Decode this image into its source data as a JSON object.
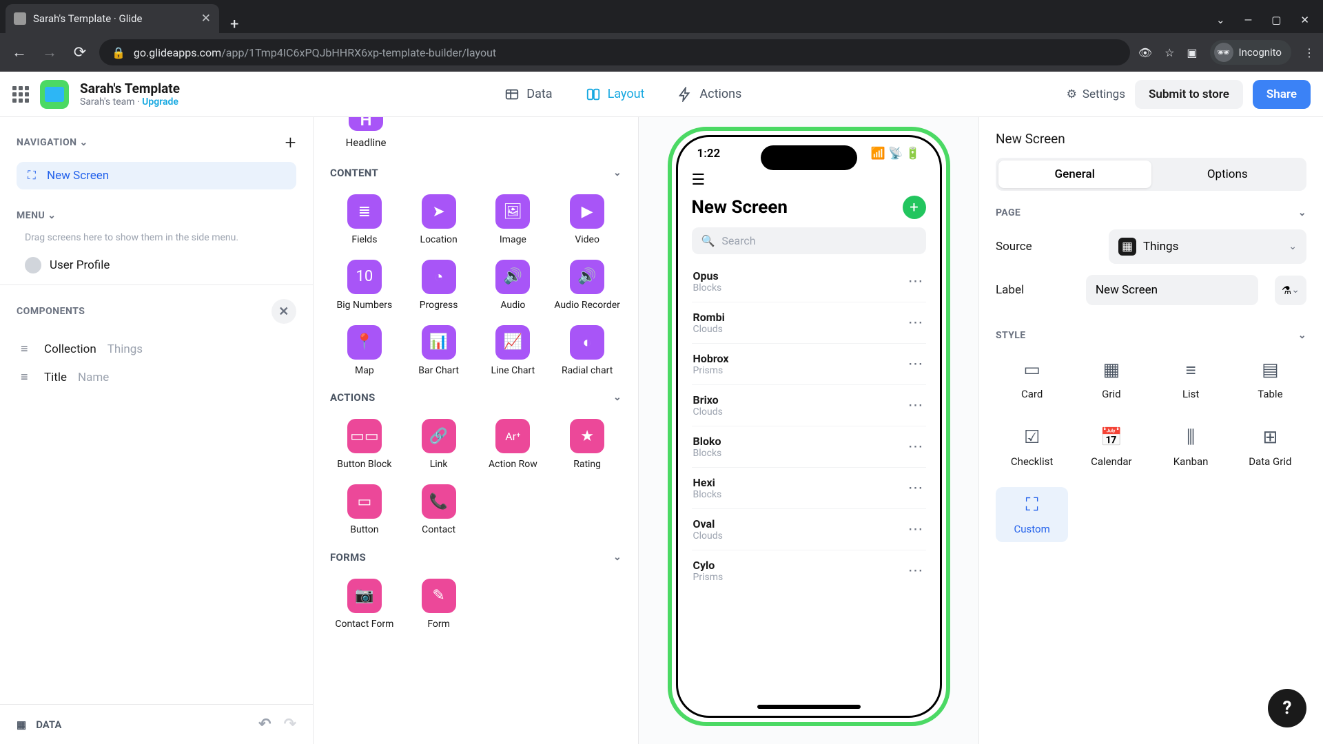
{
  "browser": {
    "tab_title": "Sarah's Template · Glide",
    "url_host": "go.glideapps.com",
    "url_path": "/app/1Tmp4IC6xPQJbHHRX6xp-template-builder/layout",
    "incognito": "Incognito"
  },
  "header": {
    "title": "Sarah's Template",
    "subtitle_team": "Sarah's team",
    "upgrade": "Upgrade",
    "tabs": {
      "data": "Data",
      "layout": "Layout",
      "actions": "Actions"
    },
    "settings": "Settings",
    "submit": "Submit to store",
    "share": "Share"
  },
  "left": {
    "navigation_label": "NAVIGATION",
    "nav_item": "New Screen",
    "menu_label": "MENU",
    "menu_hint": "Drag screens here to show them in the side menu.",
    "user_profile": "User Profile",
    "components_label": "COMPONENTS",
    "components": [
      {
        "name": "Collection",
        "sub": "Things"
      },
      {
        "name": "Title",
        "sub": "Name"
      }
    ],
    "data_footer": "DATA"
  },
  "component_panel": {
    "headline_label": "Headline",
    "sections": {
      "content": {
        "label": "CONTENT",
        "items": [
          "Fields",
          "Location",
          "Image",
          "Video",
          "Big Numbers",
          "Progress",
          "Audio",
          "Audio Recorder",
          "Map",
          "Bar Chart",
          "Line Chart",
          "Radial chart"
        ]
      },
      "actions": {
        "label": "ACTIONS",
        "items": [
          "Button Block",
          "Link",
          "Action Row",
          "Rating",
          "Button",
          "Contact"
        ]
      },
      "forms": {
        "label": "FORMS",
        "items": [
          "Contact Form",
          "Form"
        ]
      }
    }
  },
  "phone": {
    "time": "1:22",
    "title": "New Screen",
    "search_placeholder": "Search",
    "items": [
      {
        "title": "Opus",
        "sub": "Blocks"
      },
      {
        "title": "Rombi",
        "sub": "Clouds"
      },
      {
        "title": "Hobrox",
        "sub": "Prisms"
      },
      {
        "title": "Brixo",
        "sub": "Clouds"
      },
      {
        "title": "Bloko",
        "sub": "Blocks"
      },
      {
        "title": "Hexi",
        "sub": "Blocks"
      },
      {
        "title": "Oval",
        "sub": "Clouds"
      },
      {
        "title": "Cylo",
        "sub": "Prisms"
      }
    ]
  },
  "right": {
    "title": "New Screen",
    "tabs": {
      "general": "General",
      "options": "Options"
    },
    "page_label": "PAGE",
    "source_label": "Source",
    "source_value": "Things",
    "label_label": "Label",
    "label_value": "New Screen",
    "style_label": "STYLE",
    "styles": [
      "Card",
      "Grid",
      "List",
      "Table",
      "Checklist",
      "Calendar",
      "Kanban",
      "Data Grid",
      "Custom"
    ]
  }
}
